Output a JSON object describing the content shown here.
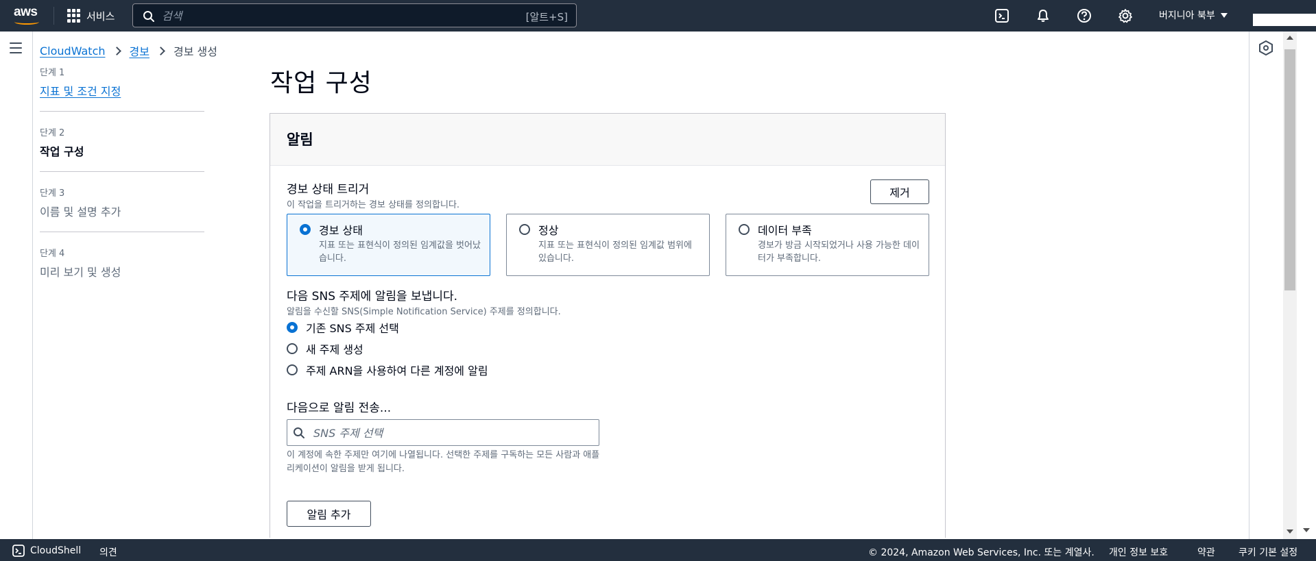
{
  "topnav": {
    "logo_text": "aws",
    "services_label": "서비스",
    "search_placeholder": "검색",
    "search_shortcut": "[알트+S]",
    "region_label": "버지니아 북부"
  },
  "breadcrumb": {
    "items": [
      "CloudWatch",
      "경보"
    ],
    "current": "경보 생성"
  },
  "steps": [
    {
      "num": "단계 1",
      "label": "지표 및 조건 지정",
      "state": "link"
    },
    {
      "num": "단계 2",
      "label": "작업 구성",
      "state": "active"
    },
    {
      "num": "단계 3",
      "label": "이름 및 설명 추가",
      "state": "disabled"
    },
    {
      "num": "단계 4",
      "label": "미리 보기 및 생성",
      "state": "disabled"
    }
  ],
  "page": {
    "title": "작업 구성"
  },
  "notification": {
    "header": "알림",
    "trigger_title": "경보 상태 트리거",
    "trigger_desc": "이 작업을 트리거하는 경보 상태를 정의합니다.",
    "remove_label": "제거",
    "tiles": [
      {
        "title": "경보 상태",
        "desc": "지표 또는 표현식이 정의된 임계값을 벗어났습니다.",
        "selected": true
      },
      {
        "title": "정상",
        "desc": "지표 또는 표현식이 정의된 임계값 범위에 있습니다.",
        "selected": false
      },
      {
        "title": "데이터 부족",
        "desc": "경보가 방금 시작되었거나 사용 가능한 데이터가 부족합니다.",
        "selected": false
      }
    ],
    "sns_title": "다음 SNS 주제에 알림을 보냅니다.",
    "sns_desc": "알림을 수신할 SNS(Simple Notification Service) 주제를 정의합니다.",
    "sns_options": [
      {
        "label": "기존 SNS 주제 선택",
        "selected": true
      },
      {
        "label": "새 주제 생성",
        "selected": false
      },
      {
        "label": "주제 ARN을 사용하여 다른 계정에 알림",
        "selected": false
      }
    ],
    "send_title": "다음으로 알림 전송...",
    "sns_search_placeholder": "SNS 주제 선택",
    "sns_help": "이 계정에 속한 주제만 여기에 나열됩니다. 선택한 주제를 구독하는 모든 사람과 애플리케이션이 알림을 받게 됩니다.",
    "add_label": "알림 추가"
  },
  "footer": {
    "cloudshell": "CloudShell",
    "feedback": "의견",
    "copyright": "© 2024, Amazon Web Services, Inc. 또는 계열사.",
    "privacy": "개인 정보 보호",
    "terms": "약관",
    "cookies": "쿠키 기본 설정"
  },
  "colors": {
    "nav_bg": "#232f3e",
    "accent": "#0972d3",
    "aws_orange": "#ff9900"
  },
  "icons": [
    "grid-icon",
    "search-icon",
    "cloudshell-icon",
    "bell-icon",
    "help-icon",
    "gear-icon",
    "hamburger-icon",
    "chevron-right-icon",
    "info-panel-icon"
  ]
}
